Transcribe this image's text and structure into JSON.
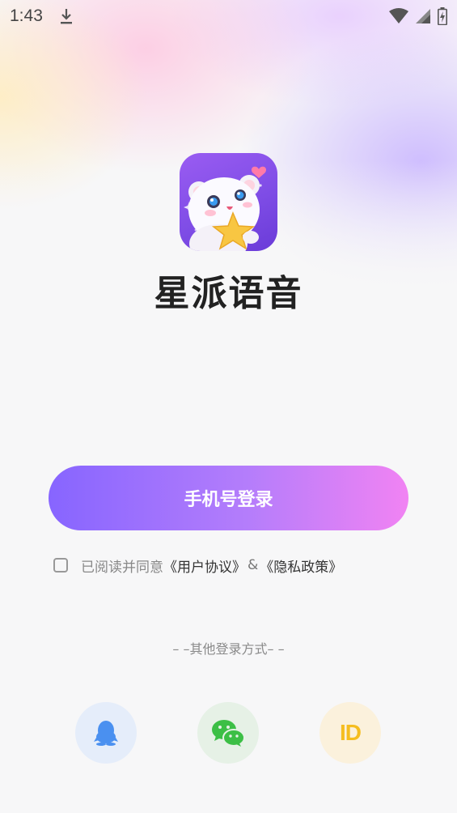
{
  "status_bar": {
    "time": "1:43",
    "icons": [
      "download-icon",
      "wifi-icon",
      "cellular-signal-icon",
      "battery-charging-icon"
    ]
  },
  "app": {
    "name": "星派语音",
    "icon": "app-logo-bear-star",
    "icon_gradient": [
      "#9a5cf2",
      "#6a3bd8"
    ]
  },
  "login": {
    "phone_button_label": "手机号登录",
    "gradient": [
      "#8765ff",
      "#f183f3"
    ]
  },
  "agreement": {
    "prefix": "已阅读并同意",
    "user_agreement": "《用户协议》",
    "amp": "&",
    "privacy_policy": "《隐私政策》",
    "checked": false
  },
  "other_login": {
    "label": "– –其他登录方式– –",
    "methods": [
      {
        "name": "qq",
        "icon": "qq-penguin-icon",
        "color": "#4a90f0",
        "bg": "#e5edfa"
      },
      {
        "name": "wechat",
        "icon": "wechat-icon",
        "color": "#3cbf46",
        "bg": "#e6f1e6"
      },
      {
        "name": "id",
        "icon": "id-icon",
        "text": "ID",
        "color": "#f5bd1f",
        "bg": "#fbf1dc"
      }
    ]
  }
}
